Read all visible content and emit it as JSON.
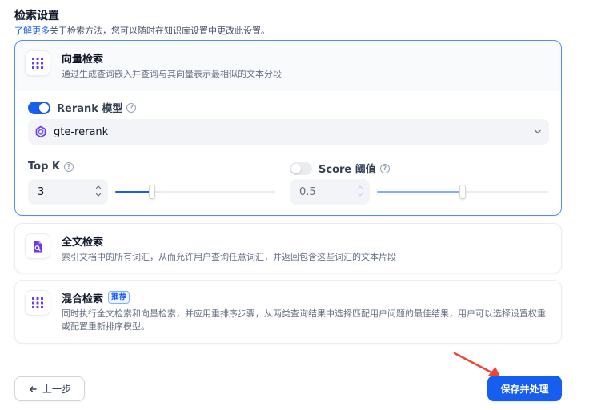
{
  "section": {
    "title": "检索设置",
    "desc_link": "了解更多",
    "desc_rest": "关于检索方法，您可以随时在知识库设置中更改此设置。"
  },
  "vector_search": {
    "title": "向量检索",
    "desc": "通过生成查询嵌入并查询与其向量表示最相似的文本分段",
    "selected": true,
    "rerank": {
      "enabled": true,
      "label": "Rerank 模型",
      "model": "gte-rerank"
    },
    "top_k": {
      "label": "Top K",
      "value": "3",
      "slider_fraction": 0.23
    },
    "score_threshold": {
      "enabled": false,
      "label": "Score 阈值",
      "value": "0.5",
      "slider_fraction": 0.5
    }
  },
  "full_text_search": {
    "title": "全文检索",
    "desc": "索引文档中的所有词汇，从而允许用户查询任意词汇，并返回包含这些词汇的文本片段"
  },
  "hybrid_search": {
    "title": "混合检索",
    "badge": "推荐",
    "desc": "同时执行全文检索和向量检索，并应用重排序步骤，从两类查询结果中选择匹配用户问题的最佳结果，用户可以选择设置权重或配置重新排序模型。"
  },
  "footer": {
    "back_label": "上一步",
    "save_label": "保存并处理"
  },
  "colors": {
    "primary": "#155eef",
    "selected_border": "#528bff",
    "icon_purple": "#6938ef",
    "annotation_red": "#f04438"
  }
}
